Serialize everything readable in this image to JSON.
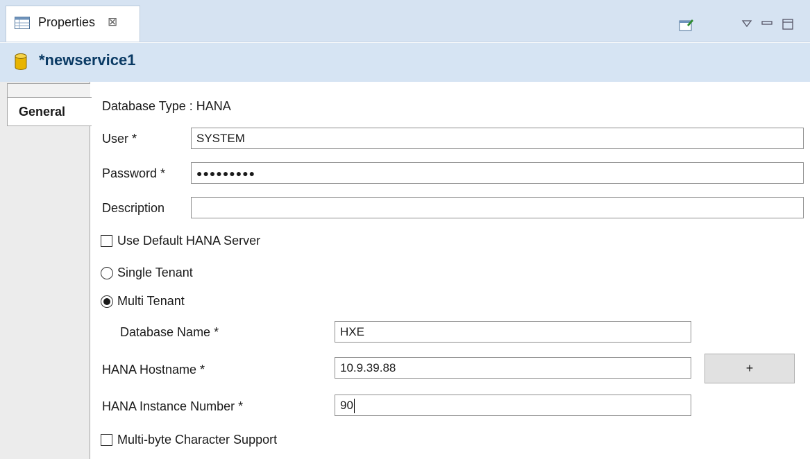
{
  "view_tab": {
    "label": "Properties",
    "close_glyph": "⊠",
    "icon": "table-icon"
  },
  "toolbar": {
    "icons": [
      "pin-icon",
      "view-menu-icon",
      "minimize-icon",
      "maximize-icon"
    ]
  },
  "title": {
    "icon": "database-icon",
    "text": "*newservice1"
  },
  "side_tabs": [
    {
      "label": "General",
      "selected": true
    }
  ],
  "form": {
    "database_type": "Database Type : HANA",
    "user": {
      "label": "User *",
      "value": "SYSTEM"
    },
    "password": {
      "label": "Password *",
      "masked_value": "●●●●●●●●●"
    },
    "description": {
      "label": "Description",
      "value": ""
    },
    "use_default_server": {
      "label": "Use Default HANA Server",
      "checked": false
    },
    "single_tenant": {
      "label": "Single Tenant",
      "selected": false
    },
    "multi_tenant": {
      "label": "Multi Tenant",
      "selected": true
    },
    "database_name": {
      "label": "Database Name *",
      "value": "HXE"
    },
    "hostname": {
      "label": "HANA Hostname *",
      "value": "10.9.39.88"
    },
    "add_button": "+",
    "instance_number": {
      "label": "HANA Instance Number *",
      "value": "90"
    },
    "multibyte_support": {
      "label": "Multi-byte Character Support",
      "checked": false
    }
  },
  "colors": {
    "tab_bar": "#d6e3f2",
    "title_text": "#0a3a64",
    "title_icon": "#e8b400"
  }
}
